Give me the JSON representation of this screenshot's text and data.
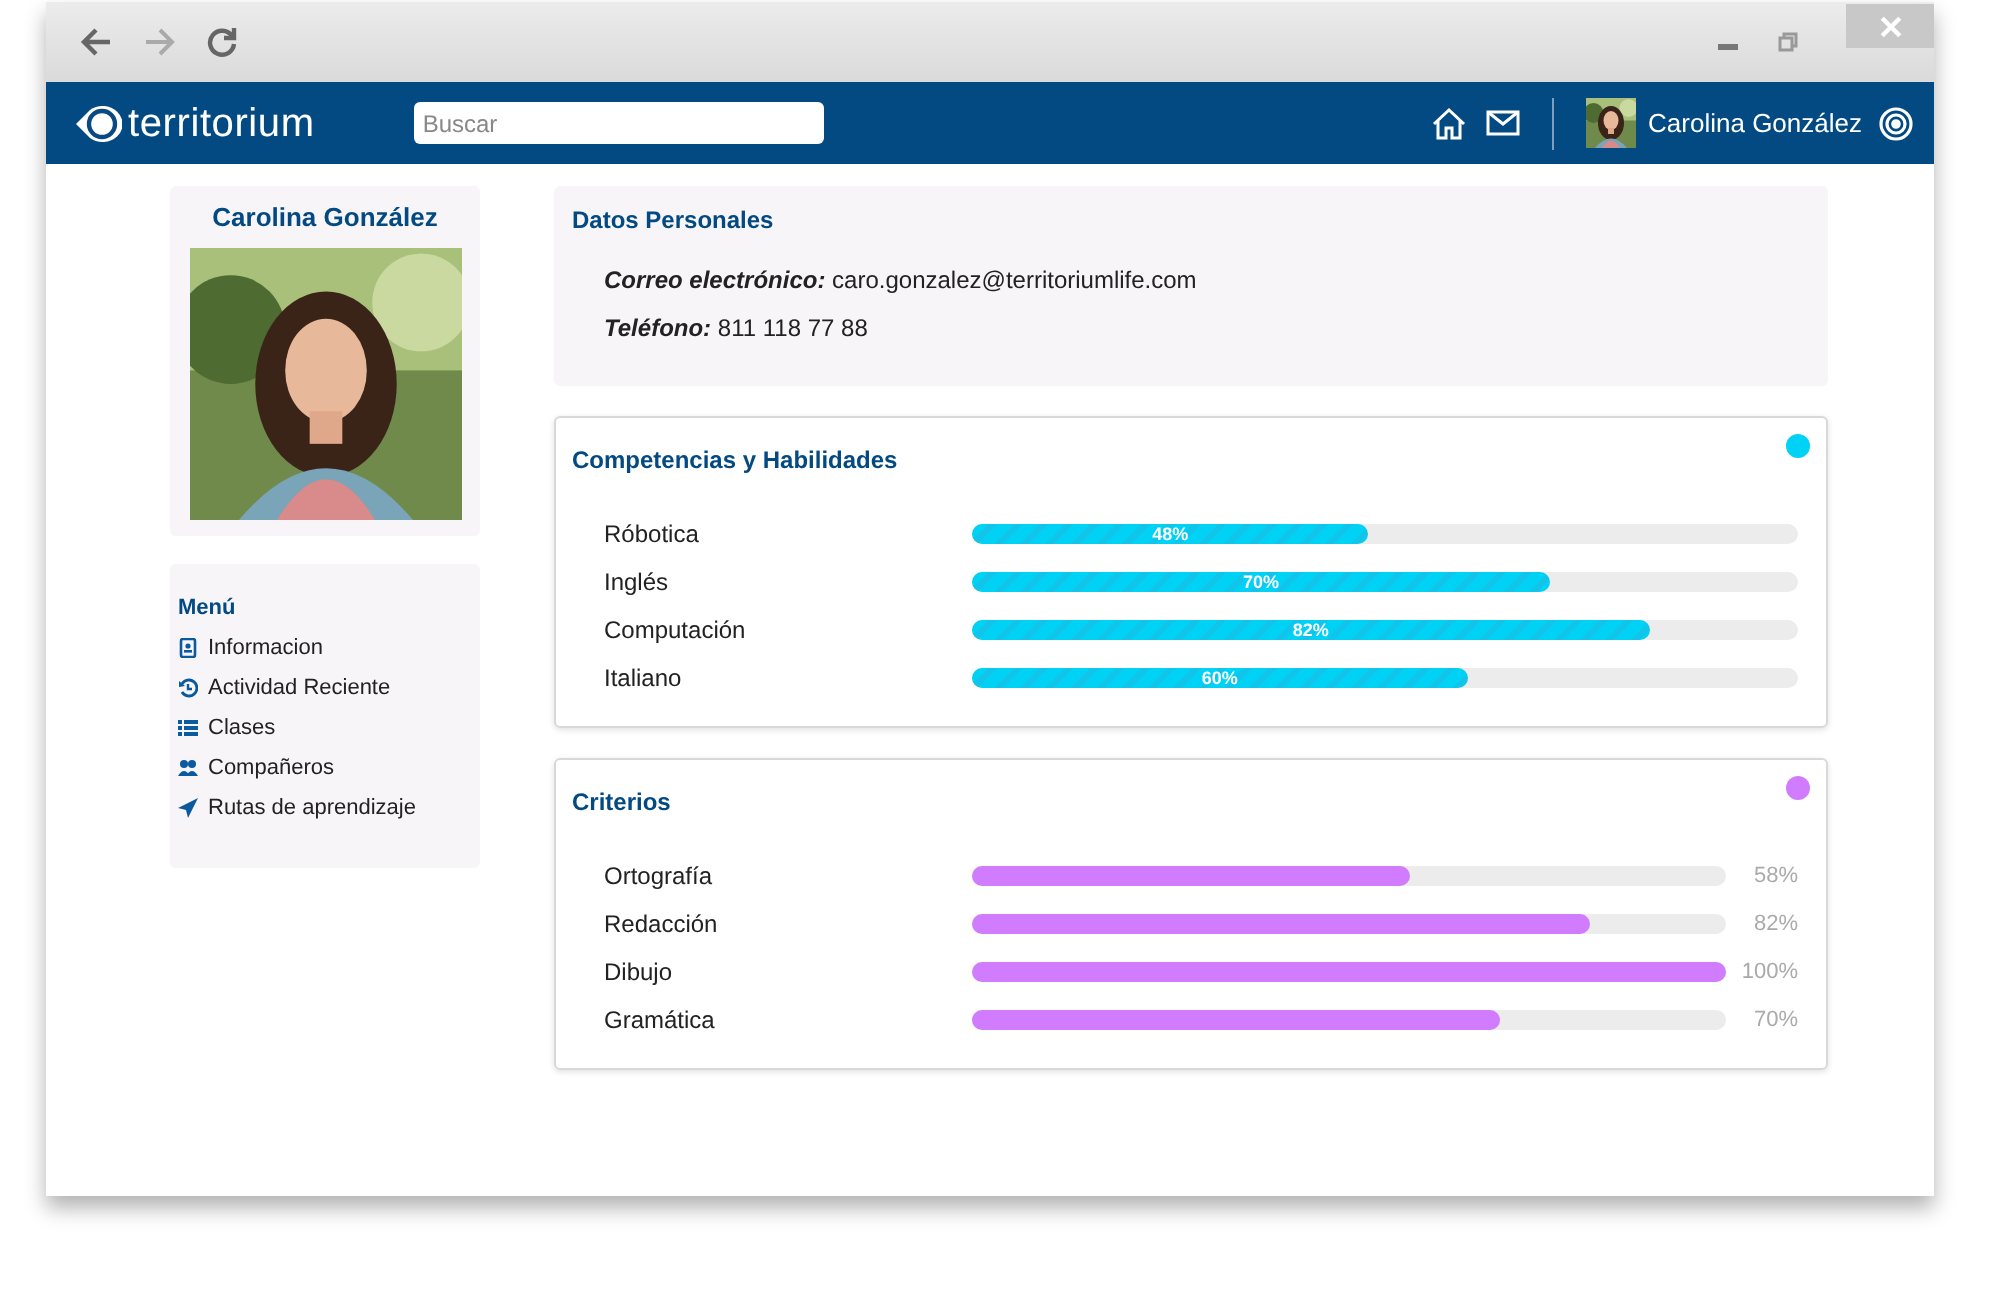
{
  "header": {
    "logo": "territorium",
    "search": {
      "placeholder": "Buscar"
    },
    "user_name": "Carolina González"
  },
  "profile": {
    "name": "Carolina González"
  },
  "menu": {
    "title": "Menú",
    "items": [
      {
        "label": "Informacion",
        "kind": "card"
      },
      {
        "label": "Actividad Reciente",
        "kind": "history"
      },
      {
        "label": "Clases",
        "kind": "list"
      },
      {
        "label": "Compañeros",
        "kind": "users"
      },
      {
        "label": "Rutas de aprendizaje",
        "kind": "send"
      }
    ]
  },
  "personal": {
    "title": "Datos Personales",
    "fields": [
      {
        "label": "Correo electrónico:",
        "value": "caro.gonzalez@territoriumlife.com"
      },
      {
        "label": "Teléfono:",
        "value": "811 118 77 88"
      }
    ]
  },
  "sections": [
    {
      "title": "Competencias y Habilidades",
      "kind": "striped",
      "color": "#00d2f5",
      "rows": [
        {
          "name": "Róbotica",
          "level": 0.48,
          "reading": "48%"
        },
        {
          "name": "Inglés",
          "level": 0.7,
          "reading": "70%"
        },
        {
          "name": "Computación",
          "level": 0.82,
          "reading": "82%"
        },
        {
          "name": "Italiano",
          "level": 0.6,
          "reading": "60%"
        }
      ]
    },
    {
      "title": "Criterios",
      "kind": "plain",
      "color": "#d17bff",
      "rows": [
        {
          "name": "Ortografía",
          "level": 0.58,
          "reading": "58%"
        },
        {
          "name": "Redacción",
          "level": 0.82,
          "reading": "82%"
        },
        {
          "name": "Dibujo",
          "level": 1,
          "reading": "100%"
        },
        {
          "name": "Gramática",
          "level": 0.7,
          "reading": "70%"
        }
      ]
    }
  ]
}
